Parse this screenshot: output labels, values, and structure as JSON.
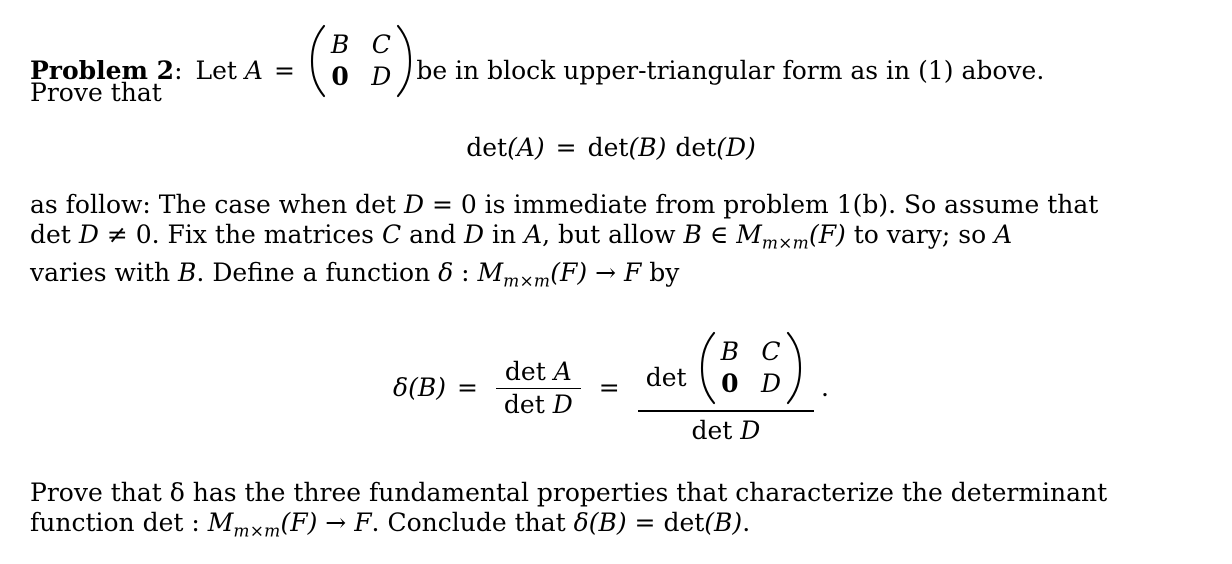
{
  "document": {
    "type": "math-problem-statement",
    "problem_label": "Problem 2",
    "colon": ":",
    "intro": {
      "before_matrix": "Let ",
      "matrix_var": "A",
      "equals": "=",
      "matrix": {
        "rows": [
          [
            "B",
            "C"
          ],
          [
            "0",
            "D"
          ]
        ],
        "bold_cells": [
          "0"
        ],
        "bracket": "parenthesis"
      },
      "after_matrix": "be in block upper-triangular form as in (1) above.",
      "prove_that": "Prove that"
    },
    "equation_det": {
      "lhs_fn": "det",
      "lhs_arg": "(A)",
      "equals": "=",
      "rhs_fn_1": "det",
      "rhs_arg_1": "(B)",
      "rhs_fn_2": "det",
      "rhs_arg_2": "(D)",
      "plain": "det(A) = det(B) det(D)"
    },
    "paragraph_assume": {
      "line1_a": "as follow: The case when det",
      "line1_b": "D",
      "line1_c": "= 0 is immediate from problem 1(b). So assume that",
      "line2_a": "det",
      "line2_b": "D",
      "line2_c": "≠ 0. Fix the matrices",
      "line2_d": "C",
      "line2_e": "and",
      "line2_f": "D",
      "line2_g": "in",
      "line2_h": "A",
      "line2_i": ", but allow",
      "line2_j": "B",
      "line2_k": "∈",
      "line2_l": "M",
      "line2_sub": "m×m",
      "line2_m": "(F)",
      "line2_n": "to vary; so",
      "line2_o": "A",
      "line3_a": "varies with",
      "line3_b": "B",
      "line3_c": ". Define a function",
      "line3_delta": "δ",
      "line3_colon": ":",
      "line3_M": "M",
      "line3_sub": "m×m",
      "line3_F1": "(F)",
      "line3_arrow": "→",
      "line3_F2": "F",
      "line3_by": "by",
      "plain": "as follow: The case when det D = 0 is immediate from problem 1(b). So assume that det D ≠ 0. Fix the matrices C and D in A, but allow B ∈ M_{m×m}(F) to vary; so A varies with B. Define a function δ : M_{m×m}(F) → F by"
    },
    "equation_delta": {
      "lhs_delta": "δ",
      "lhs_arg": "(B)",
      "equals_1": "=",
      "frac1_num_fn": "det",
      "frac1_num_var": "A",
      "frac1_den_fn": "det",
      "frac1_den_var": "D",
      "equals_2": "=",
      "frac2_num_fn": "det",
      "frac2_matrix": {
        "rows": [
          [
            "B",
            "C"
          ],
          [
            "0",
            "D"
          ]
        ],
        "bold_cells": [
          "0"
        ],
        "bracket": "parenthesis"
      },
      "frac2_den_fn": "det",
      "frac2_den_var": "D",
      "trailing_punctuation": ".",
      "plain": "δ(B) = det A / det D = det (B C; 0 D) / det D ."
    },
    "paragraph_conclude": {
      "line1": "Prove that δ has the three fundamental properties that characterize the determinant",
      "line2_a": "function det :",
      "line2_M": "M",
      "line2_sub": "m×m",
      "line2_F1": "(F)",
      "line2_arrow": "→",
      "line2_F2": "F",
      "line2_b": ". Conclude that",
      "line2_delta": "δ",
      "line2_deltaarg": "(B)",
      "line2_eq": "=",
      "line2_det": "det",
      "line2_detarg": "(B)",
      "line2_end": ".",
      "plain": "Prove that δ has the three fundamental properties that characterize the determinant function det : M_{m×m}(F) → F. Conclude that δ(B) = det(B)."
    },
    "colors": {
      "background": "#ffffff",
      "text": "#000000"
    }
  }
}
